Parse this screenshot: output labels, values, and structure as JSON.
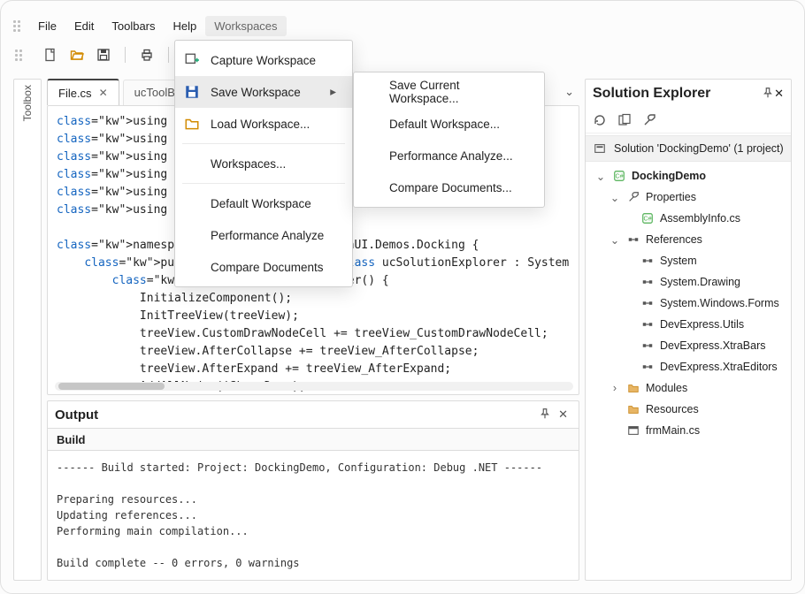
{
  "menubar": {
    "items": [
      "File",
      "Edit",
      "Toolbars",
      "Help",
      "Workspaces"
    ],
    "active_index": 4
  },
  "workspaces_menu": {
    "items": [
      {
        "label": "Capture Workspace",
        "icon": "capture"
      },
      {
        "label": "Save Workspace",
        "icon": "save",
        "submenu": true,
        "selected": true
      },
      {
        "label": "Load Workspace...",
        "icon": "folder"
      },
      {
        "sep": true
      },
      {
        "label": "Workspaces..."
      },
      {
        "sep": true
      },
      {
        "label": "Default Workspace"
      },
      {
        "label": "Performance Analyze"
      },
      {
        "label": "Compare Documents"
      }
    ],
    "save_submenu": [
      {
        "label": "Save Current Workspace..."
      },
      {
        "label": "Default Workspace..."
      },
      {
        "label": "Performance Analyze..."
      },
      {
        "label": "Compare Documents..."
      }
    ]
  },
  "toolbox": {
    "title": "Toolbox"
  },
  "tabs": {
    "tabs": [
      {
        "label": "File.cs",
        "closable": true,
        "active": true
      },
      {
        "label": "ucToolBox.cs",
        "closable": false,
        "active": false
      }
    ]
  },
  "code": "using System;\nusing System.Drawing;\nusing System.Windows.Forms;\nusing DevExpress.XtraBars.Docking;\nusing DevExpress.XtraEditors;\nusing DevExpress.XtraTreeList;\n\nnamespace DevExpress.ApplicationUI.Demos.Docking {\n    public partial class ucSolutionExplorer : System.Windows.Forms.UserControl {\n        public ucSolutionExplorer() {\n            InitializeComponent();\n            InitTreeView(treeView);\n            treeView.CustomDrawNodeCell += treeView_CustomDrawNodeCell;\n            treeView.AfterCollapse += treeView_AfterCollapse;\n            treeView.AfterExpand += treeView_AfterExpand;\n            AddAllNodes(iShow.Down);\n        }",
  "output": {
    "title": "Output",
    "subtab": "Build",
    "body": "------ Build started: Project: DockingDemo, Configuration: Debug .NET ------\n\nPreparing resources...\nUpdating references...\nPerforming main compilation...\n\nBuild complete -- 0 errors, 0 warnings"
  },
  "explorer": {
    "title": "Solution Explorer",
    "solution": "Solution 'DockingDemo' (1 project)",
    "project": "DockingDemo",
    "properties_label": "Properties",
    "assembly": "AssemblyInfo.cs",
    "references_label": "References",
    "refs": [
      "System",
      "System.Drawing",
      "System.Windows.Forms",
      "DevExpress.Utils",
      "DevExpress.XtraBars",
      "DevExpress.XtraEditors"
    ],
    "modules_label": "Modules",
    "resources_label": "Resources",
    "frm": "frmMain.cs"
  }
}
